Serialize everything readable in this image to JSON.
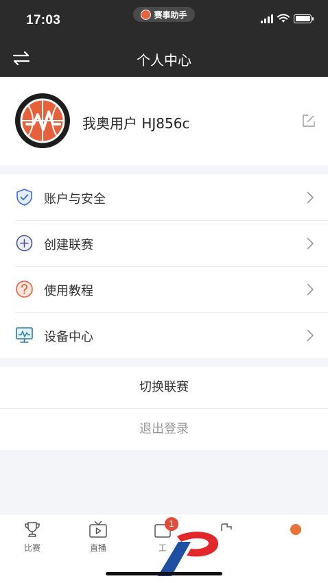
{
  "status_bar": {
    "time": "17:03",
    "app_name": "赛事助手",
    "battery_level": 1.0
  },
  "nav": {
    "title": "个人中心",
    "left_icon": "switch-arrows-icon"
  },
  "profile": {
    "username": "我奥用户 HJ856c",
    "avatar_icon": "basketball-logo",
    "edit_icon": "edit-icon"
  },
  "menu": [
    {
      "label": "账户与安全",
      "icon": "shield-check-icon"
    },
    {
      "label": "创建联赛",
      "icon": "plus-circle-icon"
    },
    {
      "label": "使用教程",
      "icon": "question-circle-icon"
    },
    {
      "label": "设备中心",
      "icon": "monitor-icon"
    }
  ],
  "actions": {
    "switch_league": "切换联赛",
    "logout": "退出登录"
  },
  "tabs": [
    {
      "label": "比赛",
      "icon": "trophy-icon"
    },
    {
      "label": "直播",
      "icon": "tv-play-icon"
    },
    {
      "label": "工",
      "icon": "tools-icon",
      "badge": "1"
    },
    {
      "label": "",
      "icon": "tab-icon-4"
    },
    {
      "label": "",
      "icon": "profile-tab-icon"
    }
  ],
  "colors": {
    "dark_header": "#2b2b2b",
    "brand_orange": "#e8603a",
    "badge_red": "#e34a3a",
    "icon_blue": "#3a6fd6",
    "logout_gray": "#999999"
  }
}
